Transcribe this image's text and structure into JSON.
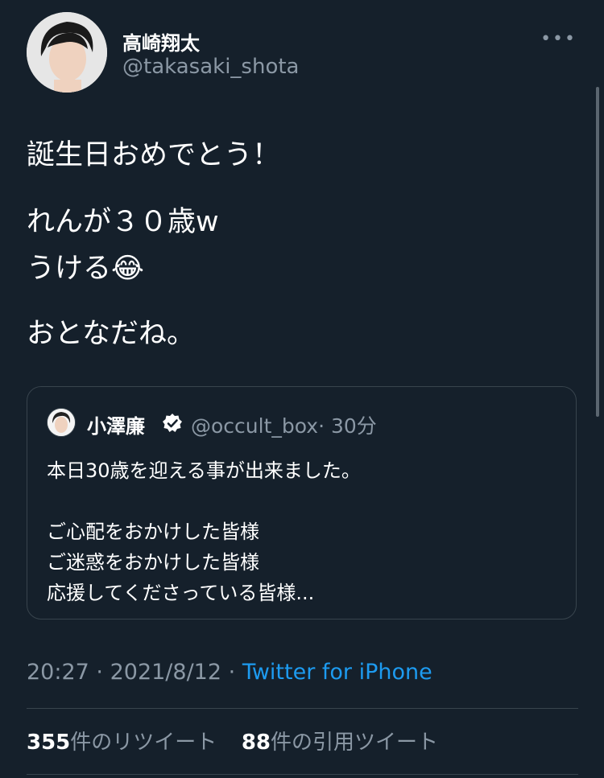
{
  "tweet": {
    "author": {
      "name": "高崎翔太",
      "handle": "@takasaki_shota"
    },
    "more_icon": "•••",
    "lines": [
      "誕生日おめでとう！",
      "れんが３０歳w",
      "うける",
      "おとなだね。"
    ],
    "emoji": "😂"
  },
  "quoted": {
    "author": {
      "name": "小澤廉",
      "handle": "@occult_box",
      "time": "· 30分"
    },
    "lines": [
      "本日30歳を迎える事が出来ました。",
      "ご心配をおかけした皆様",
      "ご迷惑をおかけした皆様",
      "応援してくださっている皆様..."
    ]
  },
  "meta": {
    "time": "20:27",
    "sep": "·",
    "date": "2021/8/12",
    "source": "Twitter for iPhone"
  },
  "stats": {
    "retweets": {
      "count": "355",
      "label": "件のリツイート"
    },
    "quotes": {
      "count": "88",
      "label": "件の引用ツイート"
    }
  },
  "colors": {
    "background": "#15202b",
    "secondary_text": "#8b98a5",
    "link": "#1d9bf0",
    "border": "#38444d"
  }
}
